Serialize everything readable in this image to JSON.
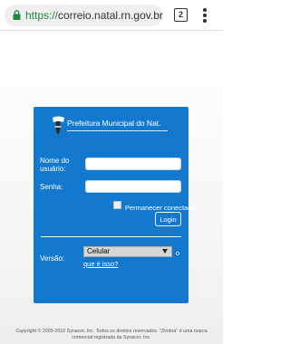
{
  "browser": {
    "url_scheme": "https://",
    "url_host": "correio.natal.rn.gov.br",
    "tab_count": "2",
    "icons": [
      "lock-icon",
      "tabs-icon",
      "more-vert-icon"
    ],
    "colors": {
      "url_scheme": "#1b8a3a"
    }
  },
  "login": {
    "brand_name": "Prefeitura Municipal do Nat.",
    "username_label": "Nome do usuário:",
    "username_value": "",
    "password_label": "Senha:",
    "password_value": "",
    "remember_label": "Permanecer conectado",
    "login_button": "Login",
    "version_label": "Versão:",
    "version_selected": "Celular",
    "help_link_part1": "o",
    "help_link_part2": "que é isso?",
    "colors": {
      "panel": "#1279cf"
    }
  },
  "footer": {
    "line1": "Copyright © 2005-2016 Synacor, Inc. Todos os direitos reservados. \"Zimbra\" é uma marca",
    "line2": "comercial registrada da Synacor, Inc."
  }
}
